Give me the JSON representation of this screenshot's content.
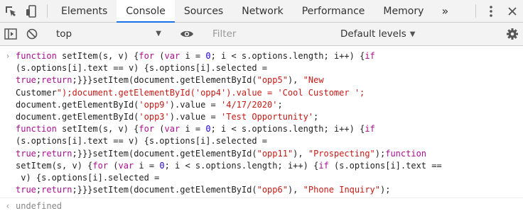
{
  "tabs": [
    "Elements",
    "Console",
    "Sources",
    "Network",
    "Performance",
    "Memory"
  ],
  "more_label": "»",
  "toolbar": {
    "context": "top",
    "filter_placeholder": "Filter",
    "levels_label": "Default levels"
  },
  "console": {
    "result": "undefined",
    "lines": [
      "function setItem(s, v) {for (var i = 0; i < s.options.length; i++) {if",
      "(s.options[i].text == v) {s.options[i].selected =",
      "true;return;}}}setItem(document.getElementById(\"opp5\"), \"New",
      "Customer\");document.getElementById('opp4').value = 'Cool Customer ';",
      "document.getElementById('opp9').value = '4/17/2020';",
      "document.getElementById('opp3').value = 'Test Opportunity';",
      "function setItem(s, v) {for (var i = 0; i < s.options.length; i++) {if",
      "(s.options[i].text == v) {s.options[i].selected =",
      "true;return;}}}setItem(document.getElementById(\"opp11\"), \"Prospecting\");function",
      "setItem(s, v) {for (var i = 0; i < s.options.length; i++) {if (s.options[i].text ==",
      " v) {s.options[i].selected =",
      "true;return;}}}setItem(document.getElementById(\"opp6\"), \"Phone Inquiry\");"
    ]
  },
  "colors": {
    "keyword": "#aa0d91",
    "string": "#c41a16",
    "number": "#1c00cf",
    "active_tab": "#1a73e8"
  },
  "icons": [
    "inspect-icon",
    "device-icon",
    "more-tabs-icon",
    "kebab-menu-icon",
    "close-icon",
    "sidebar-toggle-icon",
    "clear-console-icon",
    "eye-icon",
    "gear-icon",
    "prompt-chevron-icon",
    "result-arrow-icon"
  ]
}
